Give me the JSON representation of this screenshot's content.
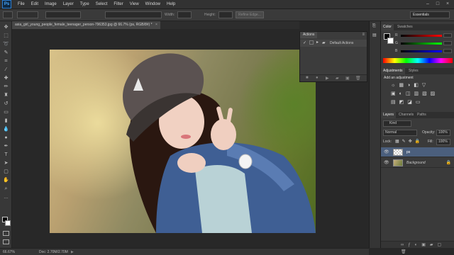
{
  "app": {
    "logo": "Ps"
  },
  "menu": [
    "File",
    "Edit",
    "Image",
    "Layer",
    "Type",
    "Select",
    "Filter",
    "View",
    "Window",
    "Help"
  ],
  "options": {
    "width_label": "Width:",
    "height_label": "Height:",
    "refine_edge_label": "Refine Edge...",
    "workspace": "Essentials"
  },
  "document": {
    "tab_label": "asia_girl_young_people_female_teenager_person-796353.jpg @ 66.7% (ps, RGB/8#) *",
    "zoom": "66.67%",
    "doc_size": "Doc: 2.70M/2.70M"
  },
  "actions_panel": {
    "tab": "Actions",
    "set_name": "Default Actions"
  },
  "color_panel": {
    "tabs": [
      "Color",
      "Swatches"
    ],
    "channels": [
      "R",
      "G",
      "B"
    ]
  },
  "adjustments_panel": {
    "tabs": [
      "Adjustments",
      "Styles"
    ],
    "hint": "Add an adjustment"
  },
  "layers_panel": {
    "tabs": [
      "Layers",
      "Channels",
      "Paths"
    ],
    "kind_label": "Kind",
    "blend_mode": "Normal",
    "opacity_label": "Opacity:",
    "opacity_value": "100%",
    "lock_label": "Lock:",
    "fill_label": "Fill:",
    "fill_value": "100%",
    "layers": [
      {
        "name": "ps",
        "selected": true
      },
      {
        "name": "Background",
        "selected": false
      }
    ]
  },
  "colors": {
    "accent": "#2c7dd1",
    "selected_layer": "#4b5f7d",
    "panel": "#3a3a3a"
  }
}
